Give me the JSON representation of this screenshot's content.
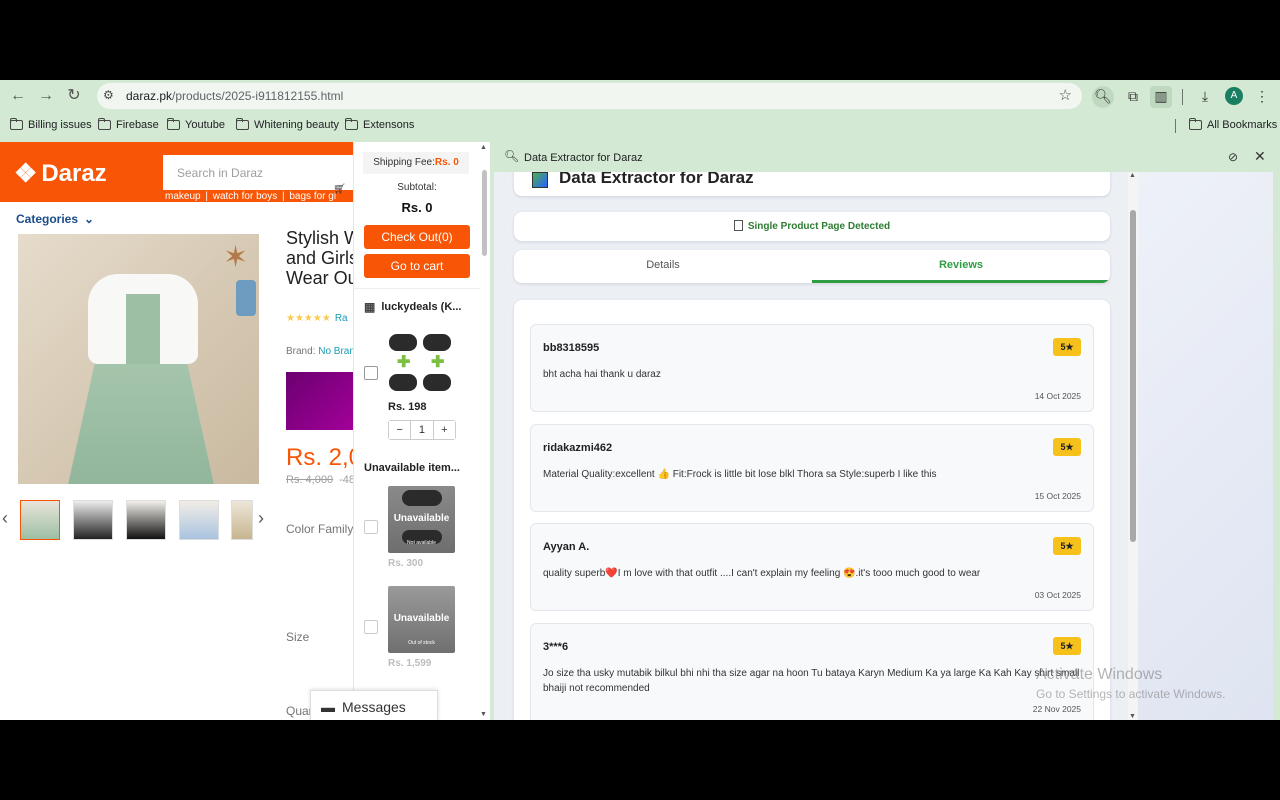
{
  "browser": {
    "url_host": "daraz.pk",
    "url_path": "/products/2025-i911812155.html",
    "avatar_letter": "A",
    "bookmarks": [
      "Billing issues",
      "Firebase",
      "Youtube",
      "Whitening beauty",
      "Extensons"
    ],
    "all_bookmarks": "All Bookmarks"
  },
  "daraz": {
    "logo": "Daraz",
    "search_placeholder": "Search in Daraz",
    "quick_links": [
      "makeup",
      "watch for boys",
      "bags for gi"
    ],
    "categories": "Categories",
    "title_lines": [
      "Stylish W",
      "and Girls",
      "Wear Ou"
    ],
    "rating_link": "Ra",
    "brand_label": "Brand:",
    "brand_value": "No Bran",
    "price": "Rs. 2,0",
    "old_price": "Rs. 4,000",
    "discount": "-48",
    "color_label": "Color Family",
    "size_label": "Size",
    "quantity_label": "Quan",
    "accent_color": "#f85606"
  },
  "cart": {
    "shipping_label": "Shipping Fee:",
    "shipping_value": "Rs. 0",
    "subtotal_label": "Subtotal:",
    "subtotal_value": "Rs. 0",
    "checkout_label": "Check Out(0)",
    "goto_cart_label": "Go to cart",
    "store_name": "luckydeals (K...",
    "item_price": "Rs. 198",
    "item_qty": "1",
    "unavailable_heading": "Unavailable item...",
    "unavailable_items": [
      {
        "overlay": "Unavailable",
        "note": "Not available",
        "price": "Rs. 300"
      },
      {
        "overlay": "Unavailable",
        "note": "Out of stock",
        "price": "Rs. 1,599"
      }
    ]
  },
  "messages": {
    "label": "Messages"
  },
  "side_panel": {
    "title": "Data Extractor for Daraz",
    "extension_title": "Data Extractor for Daraz",
    "detected": "Single Product Page Detected",
    "tabs": [
      "Details",
      "Reviews"
    ],
    "active_tab": "Reviews",
    "accent_color": "#2e9d44",
    "reviews": [
      {
        "user": "bb8318595",
        "rating": "5★",
        "text": "bht acha hai thank u daraz",
        "date": "14 Oct 2025"
      },
      {
        "user": "ridakazmi462",
        "rating": "5★",
        "text": "Material Quality:excellent 👍 Fit:Frock is little bit lose blkl Thora sa Style:superb I like this",
        "date": "15 Oct 2025"
      },
      {
        "user": "Ayyan A.",
        "rating": "5★",
        "text": "quality superb❤️I m love with that outfit ....I can't explain my feeling 😍.it's tooo much good to wear",
        "date": "03 Oct 2025"
      },
      {
        "user": "3***6",
        "rating": "5★",
        "text": "Jo size tha usky mutabik bilkul bhi nhi tha size agar na hoon Tu bataya Karyn Medium Ka ya large Ka Kah Kay shirt small bhaiji not recommended",
        "date": "22 Nov 2025"
      }
    ]
  },
  "watermark": {
    "title": "Activate Windows",
    "subtitle": "Go to Settings to activate Windows."
  }
}
